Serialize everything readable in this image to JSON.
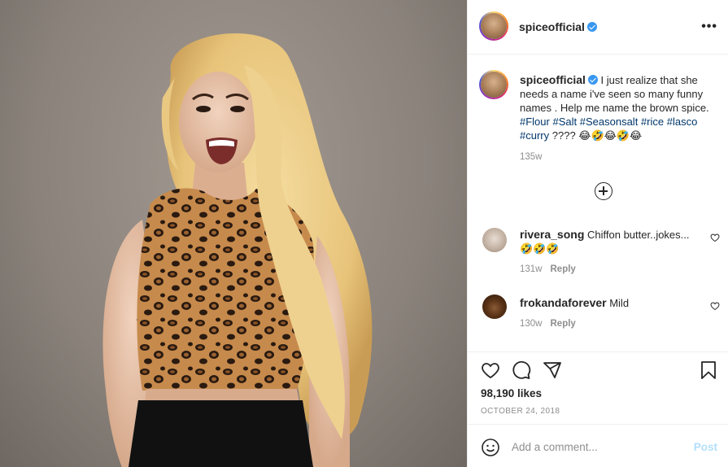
{
  "post": {
    "username": "spiceofficial",
    "verified": true,
    "more_label": "•••",
    "photo_icon": "post-photo"
  },
  "caption": {
    "username": "spiceofficial",
    "text_1": "I just realize that she needs a name i've seen so many funny names . Help me name the brown spice.",
    "hashtags": [
      "#Flour",
      "#Salt",
      "#Seasonsalt",
      "#rice",
      "#lasco",
      "#curry"
    ],
    "text_2": "????",
    "emojis": "😂🤣😂🤣😂",
    "age": "135w"
  },
  "load_more_icon": "plus-circle-icon",
  "comments": [
    {
      "username": "rivera_song",
      "text": "Chiffon butter..jokes...🤣🤣🤣",
      "age": "131w",
      "reply_label": "Reply"
    },
    {
      "username": "frokandaforever",
      "text": "Mild",
      "age": "130w",
      "reply_label": "Reply"
    }
  ],
  "actions": {
    "likes": "98,190 likes",
    "date": "OCTOBER 24, 2018",
    "icons": [
      "heart-icon",
      "comment-icon",
      "share-icon",
      "bookmark-icon"
    ]
  },
  "add_comment": {
    "emoji_icon": "emoji-icon",
    "placeholder": "Add a comment...",
    "post_label": "Post"
  },
  "colors": {
    "hashtag": "#00376b",
    "verified": "#3897f0",
    "muted": "#8e8e8e",
    "post_disabled": "#b2dffc"
  }
}
